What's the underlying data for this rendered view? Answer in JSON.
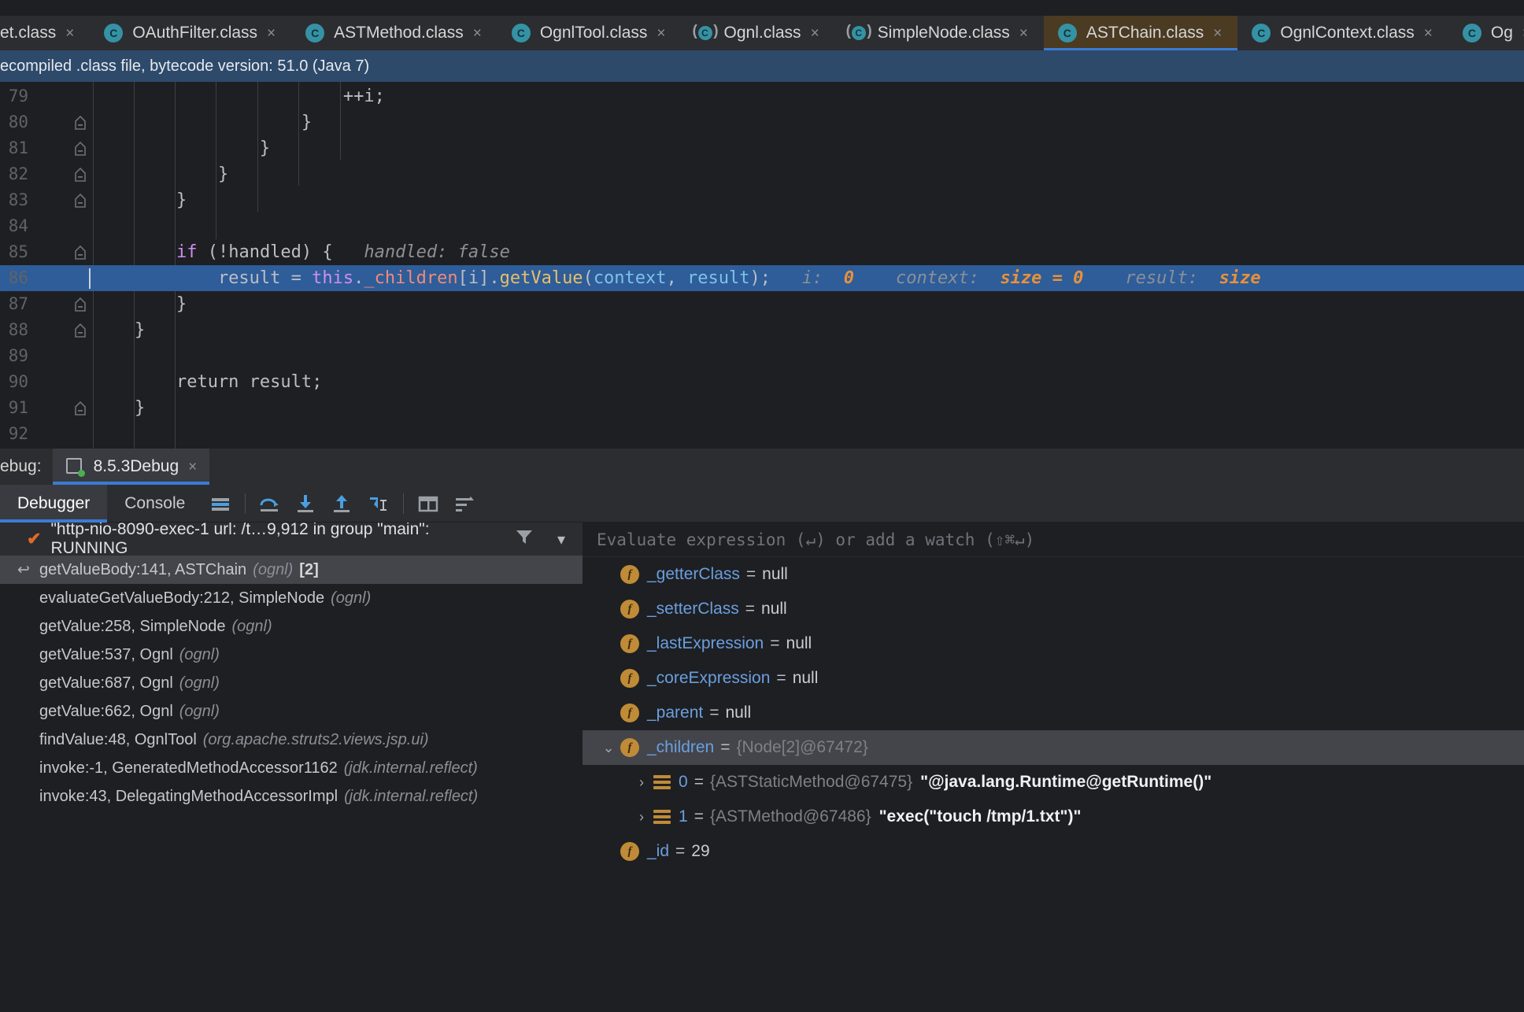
{
  "tabs": [
    {
      "label": "et.class",
      "icon": "class-icon",
      "active": false,
      "clipped": true,
      "paren": false
    },
    {
      "label": "OAuthFilter.class",
      "icon": "class-icon",
      "active": false,
      "paren": false
    },
    {
      "label": "ASTMethod.class",
      "icon": "class-icon",
      "active": false,
      "paren": false
    },
    {
      "label": "OgnlTool.class",
      "icon": "class-icon",
      "active": false,
      "paren": false
    },
    {
      "label": "Ognl.class",
      "icon": "class-icon",
      "active": false,
      "paren": true
    },
    {
      "label": "SimpleNode.class",
      "icon": "class-icon",
      "active": false,
      "paren": true
    },
    {
      "label": "ASTChain.class",
      "icon": "class-icon",
      "active": true,
      "paren": false
    },
    {
      "label": "OgnlContext.class",
      "icon": "class-icon",
      "active": false,
      "paren": false
    },
    {
      "label": "Og",
      "icon": "class-icon",
      "active": false,
      "clipped": true,
      "paren": false
    }
  ],
  "tab_close_glyph": "×",
  "notification": {
    "text": "ecompiled .class file, bytecode version: 51.0 (Java 7)",
    "background": "#2e4a6b"
  },
  "editor": {
    "lines": [
      {
        "num": "79",
        "fold": false,
        "code_html": "                        ++i;"
      },
      {
        "num": "80",
        "fold": true,
        "code_html": "                    }"
      },
      {
        "num": "81",
        "fold": true,
        "code_html": "                }"
      },
      {
        "num": "82",
        "fold": true,
        "code_html": "            }"
      },
      {
        "num": "83",
        "fold": true,
        "code_html": "        }"
      },
      {
        "num": "84",
        "fold": false,
        "code_html": ""
      },
      {
        "num": "85",
        "fold": true,
        "code_html": "        if (!handled) {"
      },
      {
        "num": "86",
        "fold": false,
        "highlight": true,
        "code_html": "            result = this._children[i].getValue(context, result);"
      },
      {
        "num": "87",
        "fold": true,
        "code_html": "        }"
      },
      {
        "num": "88",
        "fold": true,
        "code_html": "    }"
      },
      {
        "num": "89",
        "fold": false,
        "code_html": ""
      },
      {
        "num": "90",
        "fold": false,
        "code_html": "        return result;"
      },
      {
        "num": "91",
        "fold": true,
        "code_html": "    }"
      },
      {
        "num": "92",
        "fold": false,
        "code_html": ""
      }
    ],
    "tokens_line85": {
      "kw": "if",
      "rest": " (!handled) {"
    },
    "inline_hints_line85": {
      "label": "handled:",
      "value": "false"
    },
    "tokens_line86": {
      "result": "result",
      "assign": " = ",
      "this": "this",
      "dot1": ".",
      "children": "_children",
      "index": "[i]",
      "dot2": ".",
      "method": "getValue",
      "open": "(",
      "arg1": "context",
      "comma": ", ",
      "arg2": "result",
      "close": ");"
    },
    "inline_hints_line86": [
      {
        "label": "i:",
        "value": "0"
      },
      {
        "label": "context:",
        "value": "size = 0"
      },
      {
        "label": "result:",
        "value": "size"
      }
    ]
  },
  "debug_window": {
    "title": "ebug:",
    "session_tab": {
      "label": "8.5.3Debug",
      "close": "×"
    },
    "subtabs": [
      {
        "label": "Debugger",
        "active": true
      },
      {
        "label": "Console",
        "active": false
      }
    ],
    "toolbar_icons": [
      "layout-settings-icon",
      "step-over-icon",
      "step-into-icon",
      "step-out-icon",
      "run-to-cursor-icon",
      "evaluate-expression-icon",
      "sort-variables-icon"
    ]
  },
  "frames_panel": {
    "thread": {
      "status_icon": "check-icon",
      "text": "\"http-nio-8090-exec-1 url: /t…9,912 in group \"main\": RUNNING",
      "filter_icon": "filter-icon",
      "dropdown_icon": "chevron-down-icon"
    },
    "frames": [
      {
        "method": "getValueBody:141, ASTChain",
        "pkg": "(ognl)",
        "count": "[2]",
        "selected": true,
        "return_arrow": true
      },
      {
        "method": "evaluateGetValueBody:212, SimpleNode",
        "pkg": "(ognl)",
        "selected": false
      },
      {
        "method": "getValue:258, SimpleNode",
        "pkg": "(ognl)",
        "selected": false
      },
      {
        "method": "getValue:537, Ognl",
        "pkg": "(ognl)",
        "selected": false
      },
      {
        "method": "getValue:687, Ognl",
        "pkg": "(ognl)",
        "selected": false
      },
      {
        "method": "getValue:662, Ognl",
        "pkg": "(ognl)",
        "selected": false
      },
      {
        "method": "findValue:48, OgnlTool",
        "pkg": "(org.apache.struts2.views.jsp.ui)",
        "selected": false
      },
      {
        "method": "invoke:-1, GeneratedMethodAccessor1162",
        "pkg": "(jdk.internal.reflect)",
        "selected": false
      },
      {
        "method": "invoke:43, DelegatingMethodAccessorImpl",
        "pkg": "(jdk.internal.reflect)",
        "selected": false
      }
    ]
  },
  "variables_panel": {
    "watch_placeholder": "Evaluate expression (↵) or add a watch (⇧⌘↵)",
    "rows": [
      {
        "indent": 1,
        "icon": "field-icon",
        "chevron": "",
        "name": "_getterClass",
        "eq": "=",
        "value": "null",
        "value_kind": "null",
        "selected": false
      },
      {
        "indent": 1,
        "icon": "field-icon",
        "chevron": "",
        "name": "_setterClass",
        "eq": "=",
        "value": "null",
        "value_kind": "null",
        "selected": false
      },
      {
        "indent": 1,
        "icon": "field-icon",
        "chevron": "",
        "name": "_lastExpression",
        "eq": "=",
        "value": "null",
        "value_kind": "null",
        "selected": false
      },
      {
        "indent": 1,
        "icon": "field-icon",
        "chevron": "",
        "name": "_coreExpression",
        "eq": "=",
        "value": "null",
        "value_kind": "null",
        "selected": false
      },
      {
        "indent": 1,
        "icon": "field-icon",
        "chevron": "",
        "name": "_parent",
        "eq": "=",
        "value": "null",
        "value_kind": "null",
        "selected": false
      },
      {
        "indent": 1,
        "icon": "field-icon",
        "chevron": "⌄",
        "name": "_children",
        "eq": "=",
        "value": "{Node[2]@67472}",
        "value_kind": "type",
        "selected": true
      },
      {
        "indent": 2,
        "icon": "array-element-icon",
        "chevron": "›",
        "name": "0",
        "eq": "=",
        "value": "{ASTStaticMethod@67475}",
        "value_kind": "type",
        "string_value": "\"@java.lang.Runtime@getRuntime()\"",
        "selected": false
      },
      {
        "indent": 2,
        "icon": "array-element-icon",
        "chevron": "›",
        "name": "1",
        "eq": "=",
        "value": "{ASTMethod@67486}",
        "value_kind": "type",
        "string_value": "\"exec(\"touch /tmp/1.txt\")\"",
        "selected": false
      },
      {
        "indent": 1,
        "icon": "field-icon",
        "chevron": "",
        "name": "_id",
        "eq": "=",
        "value": "29",
        "value_kind": "num",
        "selected": false
      }
    ]
  },
  "colors": {
    "editor_bg": "#1e1f22",
    "panel_bg": "#2b2d30",
    "accent_blue": "#3b7bd4",
    "highlight_line": "#2e5d99",
    "selection": "#43454a",
    "active_tab_bg": "#4a3b22",
    "notification_bg": "#2e4a6b",
    "field_icon": "#c08b37",
    "var_name": "#6a9fe0",
    "keyword": "#cf8ef2",
    "field_token": "#ef8a7a",
    "method_token": "#e8bf6a",
    "param_token": "#7fc1e8",
    "hint_value": "#e8913a",
    "check_icon": "#e06c25"
  }
}
